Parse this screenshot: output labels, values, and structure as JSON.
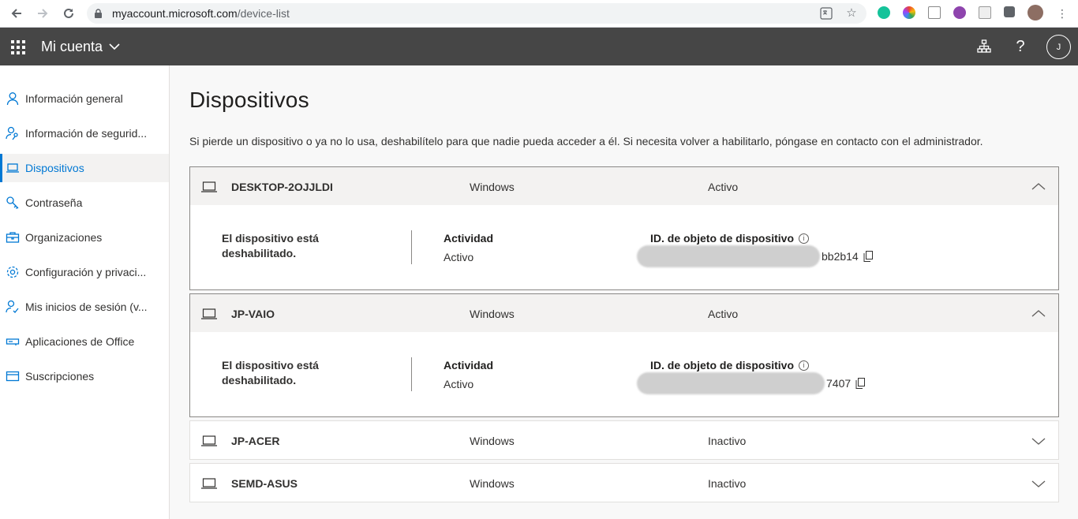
{
  "browser": {
    "url_host": "myaccount.microsoft.com",
    "url_path": "/device-list"
  },
  "header": {
    "app_title": "Mi cuenta",
    "avatar_initial": "J",
    "help_label": "?"
  },
  "sidebar": {
    "items": [
      {
        "label": "Información general",
        "icon": "person-icon"
      },
      {
        "label": "Información de segurid...",
        "icon": "person-key-icon"
      },
      {
        "label": "Dispositivos",
        "icon": "laptop-icon",
        "active": true
      },
      {
        "label": "Contraseña",
        "icon": "key-icon"
      },
      {
        "label": "Organizaciones",
        "icon": "briefcase-icon"
      },
      {
        "label": "Configuración y privaci...",
        "icon": "gear-icon"
      },
      {
        "label": "Mis inicios de sesión (v...",
        "icon": "person-check-icon"
      },
      {
        "label": "Aplicaciones de Office",
        "icon": "office-apps-icon"
      },
      {
        "label": "Suscripciones",
        "icon": "card-icon"
      }
    ]
  },
  "main": {
    "title": "Dispositivos",
    "description": "Si pierde un dispositivo o ya no lo usa, deshabilítelo para que nadie pueda acceder a él. Si necesita volver a habilitarlo, póngase en contacto con el administrador.",
    "devices": [
      {
        "name": "DESKTOP-2OJJLDI",
        "os": "Windows",
        "status": "Activo",
        "expanded": true,
        "disabled_text": "El dispositivo está deshabilitado.",
        "activity_label": "Actividad",
        "activity_value": "Activo",
        "id_label": "ID. de objeto de dispositivo",
        "id_visible_suffix": "bb2b14"
      },
      {
        "name": "JP-VAIO",
        "os": "Windows",
        "status": "Activo",
        "expanded": true,
        "disabled_text": "El dispositivo está deshabilitado.",
        "activity_label": "Actividad",
        "activity_value": "Activo",
        "id_label": "ID. de objeto de dispositivo",
        "id_visible_suffix": "7407"
      },
      {
        "name": "JP-ACER",
        "os": "Windows",
        "status": "Inactivo",
        "expanded": false
      },
      {
        "name": "SEMD-ASUS",
        "os": "Windows",
        "status": "Inactivo",
        "expanded": false
      }
    ]
  },
  "colors": {
    "accent": "#0078d4",
    "header_bg": "#464646"
  }
}
